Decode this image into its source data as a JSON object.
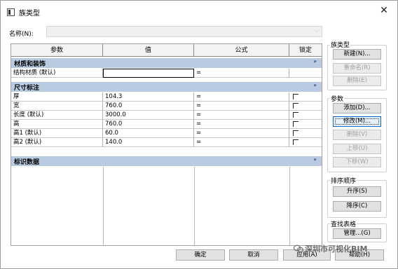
{
  "window": {
    "title": "族类型",
    "close_glyph": "✕"
  },
  "name_field": {
    "label": "名称(N):",
    "value": ""
  },
  "table": {
    "columns": [
      "参数",
      "值",
      "公式",
      "锁定"
    ],
    "groups": [
      {
        "title": "材质和装饰",
        "collapse": "»",
        "rows": [
          {
            "param": "结构材质 (默认)",
            "value": "",
            "formula": "=",
            "lock": ""
          }
        ]
      },
      {
        "title": "尺寸标注",
        "collapse": "»",
        "rows": [
          {
            "param": "厚",
            "value": "104.3",
            "formula": "=",
            "lock": "☐"
          },
          {
            "param": "宽",
            "value": "760.0",
            "formula": "=",
            "lock": "☐"
          },
          {
            "param": "长度 (默认)",
            "value": "3000.0",
            "formula": "=",
            "lock": "☐"
          },
          {
            "param": "高",
            "value": "760.0",
            "formula": "=",
            "lock": "☐"
          },
          {
            "param": "高1 (默认)",
            "value": "60.0",
            "formula": "=",
            "lock": "☐"
          },
          {
            "param": "高2 (默认)",
            "value": "140.0",
            "formula": "=",
            "lock": "☐"
          }
        ]
      },
      {
        "title": "标识数据",
        "collapse": "»",
        "rows": []
      }
    ]
  },
  "family_types": {
    "title": "族类型",
    "new": "新建(N)...",
    "rename": "重命名(R)",
    "delete": "删除(E)"
  },
  "parameters": {
    "title": "参数",
    "add": "添加(D)...",
    "modify": "修改(M)...",
    "remove": "删除(V)",
    "up": "上移(U)",
    "down": "下移(W)"
  },
  "sort_order": {
    "title": "排序顺序",
    "asc": "升序(S)",
    "desc": "降序(C)"
  },
  "lookup": {
    "title": "查找表格",
    "manage": "管理...(G)"
  },
  "footer": {
    "ok": "确定",
    "cancel": "取消",
    "apply": "应用(A)",
    "help": "帮助(H)"
  },
  "watermark": "深圳市可视化BIM"
}
